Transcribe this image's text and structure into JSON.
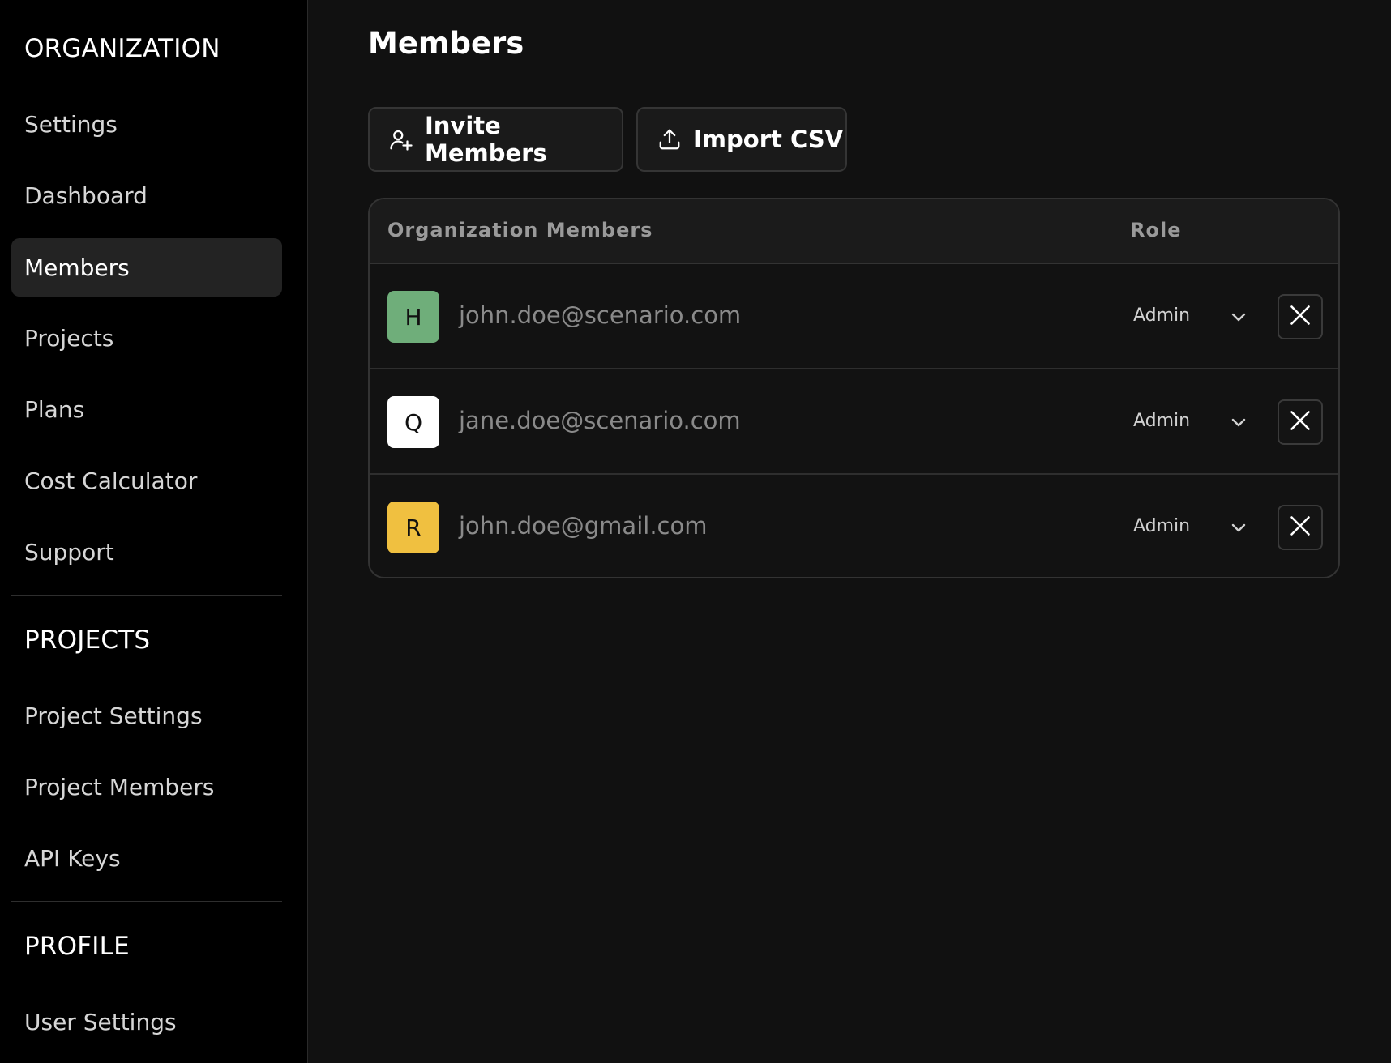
{
  "sidebar": {
    "org_title": "ORGANIZATION",
    "org_items": [
      {
        "label": "Settings"
      },
      {
        "label": "Dashboard"
      },
      {
        "label": "Members"
      },
      {
        "label": "Projects"
      },
      {
        "label": "Plans"
      },
      {
        "label": "Cost Calculator"
      },
      {
        "label": "Support"
      }
    ],
    "active_item": "Members",
    "projects_title": "PROJECTS",
    "project_items": [
      {
        "label": "Project Settings"
      },
      {
        "label": "Project Members"
      },
      {
        "label": "API Keys"
      }
    ],
    "profile_title": "PROFILE",
    "profile_items": [
      {
        "label": "User Settings"
      }
    ]
  },
  "main": {
    "title": "Members",
    "invite_label": "Invite Members",
    "import_label": "Import CSV",
    "table": {
      "col_members": "Organization Members",
      "col_role": "Role",
      "rows": [
        {
          "initial": "H",
          "email": "john.doe@scenario.com",
          "role": "Admin",
          "avatar_color": "#6fae7a"
        },
        {
          "initial": "Q",
          "email": "jane.doe@scenario.com",
          "role": "Admin",
          "avatar_color": "#ffffff"
        },
        {
          "initial": "R",
          "email": "john.doe@gmail.com",
          "role": "Admin",
          "avatar_color": "#f0c040"
        }
      ]
    }
  },
  "icons": {
    "invite": "user-plus-icon",
    "import": "upload-icon",
    "role_dropdown": "chevron-down-icon",
    "remove": "close-icon"
  },
  "colors": {
    "background": "#111111",
    "sidebar_bg": "#000000",
    "active_item_bg": "#232323"
  }
}
